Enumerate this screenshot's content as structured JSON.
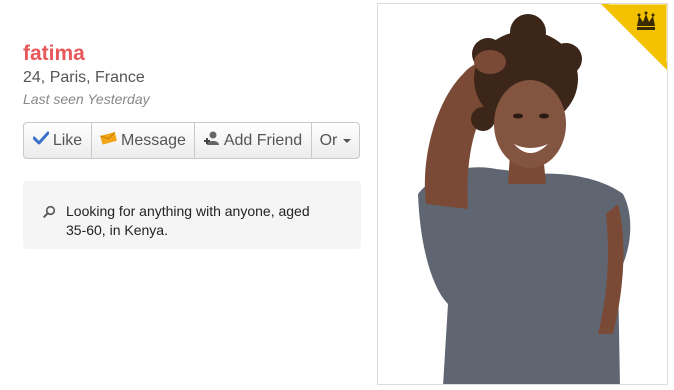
{
  "profile": {
    "name": "fatima",
    "location": "24, Paris, France",
    "last_seen": "Last seen Yesterday"
  },
  "actions": {
    "like": "Like",
    "message": "Message",
    "add_friend": "Add Friend",
    "more": "Or"
  },
  "looking_for": {
    "icon": "search-icon",
    "text": "Looking for anything with anyone, aged 35-60, in Kenya."
  },
  "photo": {
    "badge_icon": "crown-icon",
    "badge_color": "#f2c200"
  },
  "colors": {
    "name": "#e8575a",
    "like_check": "#3b6fc9",
    "message_icon": "#f2a516"
  }
}
